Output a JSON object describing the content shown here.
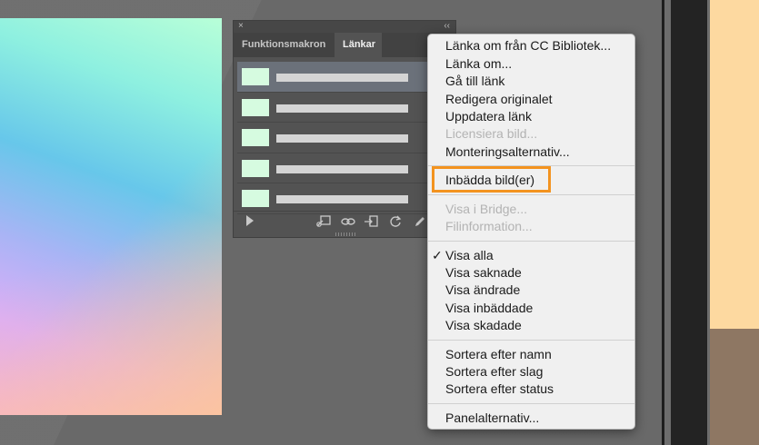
{
  "panel": {
    "tabs": [
      "Funktionsmakron",
      "Länkar"
    ],
    "active_tab": "Länkar",
    "close_glyph": "×",
    "collapse_glyph": "‹‹",
    "rows": 5,
    "icons": [
      "play-icon",
      "relink-cc-icon",
      "relink-icon",
      "place-icon",
      "update-icon",
      "edit-icon"
    ]
  },
  "menu": {
    "items": [
      {
        "label": "Länka om från CC Bibliotek...",
        "enabled": true
      },
      {
        "label": "Länka om...",
        "enabled": true
      },
      {
        "label": "Gå till länk",
        "enabled": true
      },
      {
        "label": "Redigera originalet",
        "enabled": true
      },
      {
        "label": "Uppdatera länk",
        "enabled": true
      },
      {
        "label": "Licensiera bild...",
        "enabled": false
      },
      {
        "label": "Monteringsalternativ...",
        "enabled": true
      },
      {
        "label": "Inbädda bild(er)",
        "enabled": true,
        "highlighted": true
      },
      {
        "label": "Visa i Bridge...",
        "enabled": false
      },
      {
        "label": "Filinformation...",
        "enabled": false
      },
      {
        "label": "Visa alla",
        "enabled": true,
        "checked": true
      },
      {
        "label": "Visa saknade",
        "enabled": true
      },
      {
        "label": "Visa ändrade",
        "enabled": true
      },
      {
        "label": "Visa inbäddade",
        "enabled": true
      },
      {
        "label": "Visa skadade",
        "enabled": true
      },
      {
        "label": "Sortera efter namn",
        "enabled": true
      },
      {
        "label": "Sortera efter slag",
        "enabled": true
      },
      {
        "label": "Sortera efter status",
        "enabled": true
      },
      {
        "label": "Panelalternativ...",
        "enabled": true
      }
    ],
    "check_glyph": "✓",
    "highlight_color": "#f3931f"
  }
}
